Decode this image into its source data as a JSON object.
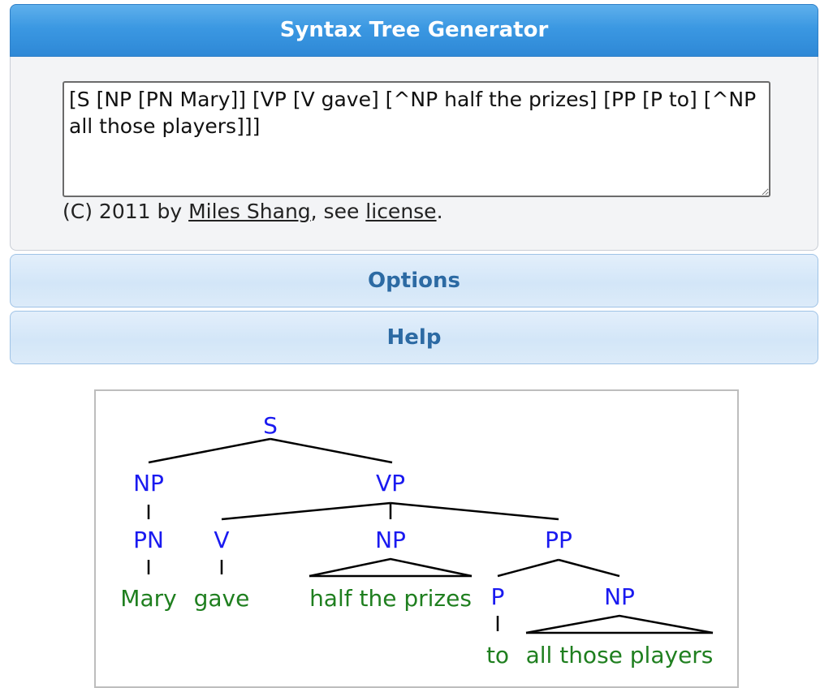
{
  "app": {
    "title": "Syntax Tree Generator"
  },
  "editor": {
    "value": "[S [NP [PN Mary]] [VP [V gave] [^NP half the prizes] [PP [P to] [^NP all those players]]]"
  },
  "footer": {
    "prefix": "(C) 2011 by ",
    "author_link": "Miles Shang",
    "middle": ", see ",
    "license_link": "license",
    "suffix": "."
  },
  "sections": {
    "options_label": "Options",
    "help_label": "Help"
  },
  "tree": {
    "category_color": "#1a1af0",
    "word_color": "#1f7f1f",
    "nodes": {
      "s": "S",
      "np_subject": "NP",
      "vp": "VP",
      "pn": "PN",
      "v": "V",
      "np_object": "NP",
      "pp": "PP",
      "p": "P",
      "np_pp": "NP"
    },
    "words": {
      "mary": "Mary",
      "gave": "gave",
      "half_the_prizes": "half the prizes",
      "to": "to",
      "all_those_players": "all those players"
    }
  }
}
